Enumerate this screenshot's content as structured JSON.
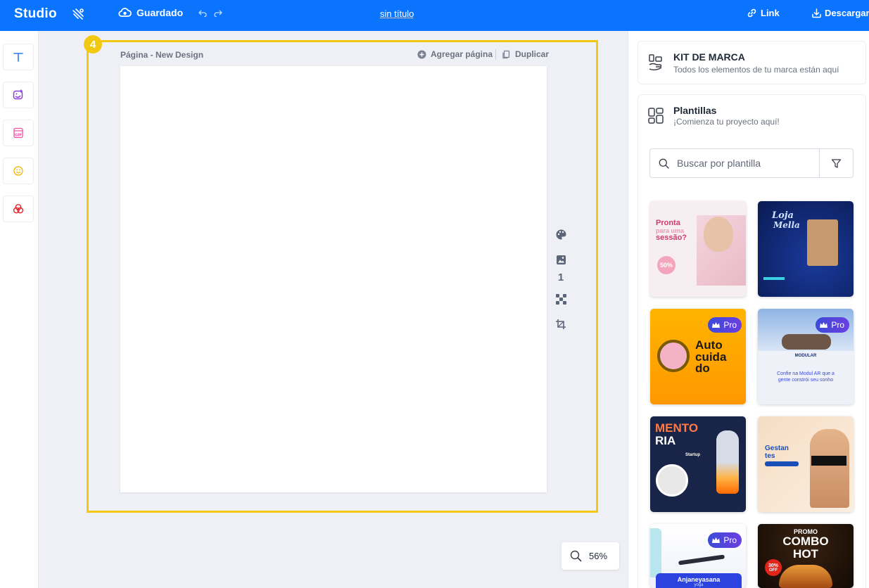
{
  "topbar": {
    "brand": "Studio",
    "saved_label": "Guardado",
    "doc_title": "sin título",
    "link_label": "Link",
    "download_label": "Descargar"
  },
  "left_toolbar": {
    "tools": [
      "text-icon",
      "image-sticker-icon",
      "gif-icon",
      "emoji-icon",
      "shapes-icon"
    ]
  },
  "canvas": {
    "step_number": "4",
    "page_label": "Página - New Design",
    "add_page_label": "Agregar página",
    "duplicate_label": "Duplicar",
    "page_number": "1",
    "zoom": "56%",
    "highlight_color": "#f2c811"
  },
  "right_panel": {
    "brand_kit": {
      "title": "KIT DE MARCA",
      "subtitle": "Todos los elementos de tu marca están aquí"
    },
    "templates": {
      "title": "Plantillas",
      "subtitle": "¡Comienza tu proyecto aquí!",
      "search_placeholder": "Buscar por plantilla",
      "items": [
        {
          "texts": [
            "Pronta",
            "para uma",
            "sessão?",
            "50%"
          ],
          "pro": false
        },
        {
          "texts": [
            "Loja",
            "Mella"
          ],
          "pro": false
        },
        {
          "texts": [
            "Auto",
            "cuida",
            "do"
          ],
          "pro": true,
          "pro_label": "Pro"
        },
        {
          "texts": [
            "MODULAR",
            "Confie na Modul AR que a",
            "gente constrói seu sonho"
          ],
          "pro": true,
          "pro_label": "Pro"
        },
        {
          "texts": [
            "MENTO",
            "RIA",
            "Startup"
          ],
          "pro": false
        },
        {
          "texts": [
            "Gestan",
            "tes"
          ],
          "pro": false
        },
        {
          "texts": [
            "Anjaneyasana",
            "yoga"
          ],
          "pro": true,
          "pro_label": "Pro"
        },
        {
          "texts": [
            "PROMO",
            "COMBO",
            "HOT",
            "30%",
            "OFF"
          ],
          "pro": false
        }
      ]
    }
  },
  "colors": {
    "topbar": "#0a74ff",
    "accent": "#3b4bd8"
  }
}
